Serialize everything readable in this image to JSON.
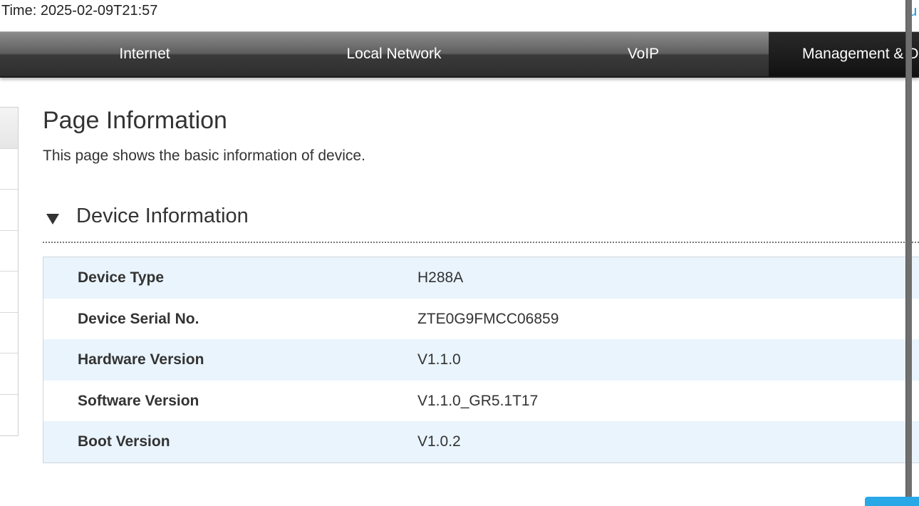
{
  "header": {
    "time_label": "Time: 2025-02-09T21:57",
    "user_link": "u"
  },
  "nav": {
    "items": [
      {
        "label": "Internet"
      },
      {
        "label": "Local Network"
      },
      {
        "label": "VoIP"
      },
      {
        "label": "Management & D",
        "active": true
      }
    ]
  },
  "page": {
    "title": "Page Information",
    "description": "This page shows the basic information of device."
  },
  "section": {
    "title": "Device Information",
    "expanded": true
  },
  "device_info": [
    {
      "label": "Device Type",
      "value": "H288A"
    },
    {
      "label": "Device Serial No.",
      "value": "ZTE0G9FMCC06859"
    },
    {
      "label": "Hardware Version",
      "value": "V1.1.0"
    },
    {
      "label": "Software Version",
      "value": "V1.1.0_GR5.1T17"
    },
    {
      "label": "Boot Version",
      "value": "V1.0.2"
    }
  ],
  "colors": {
    "accent": "#1a8fd8",
    "row_alt": "#eaf4fd",
    "button": "#29a8e8"
  }
}
